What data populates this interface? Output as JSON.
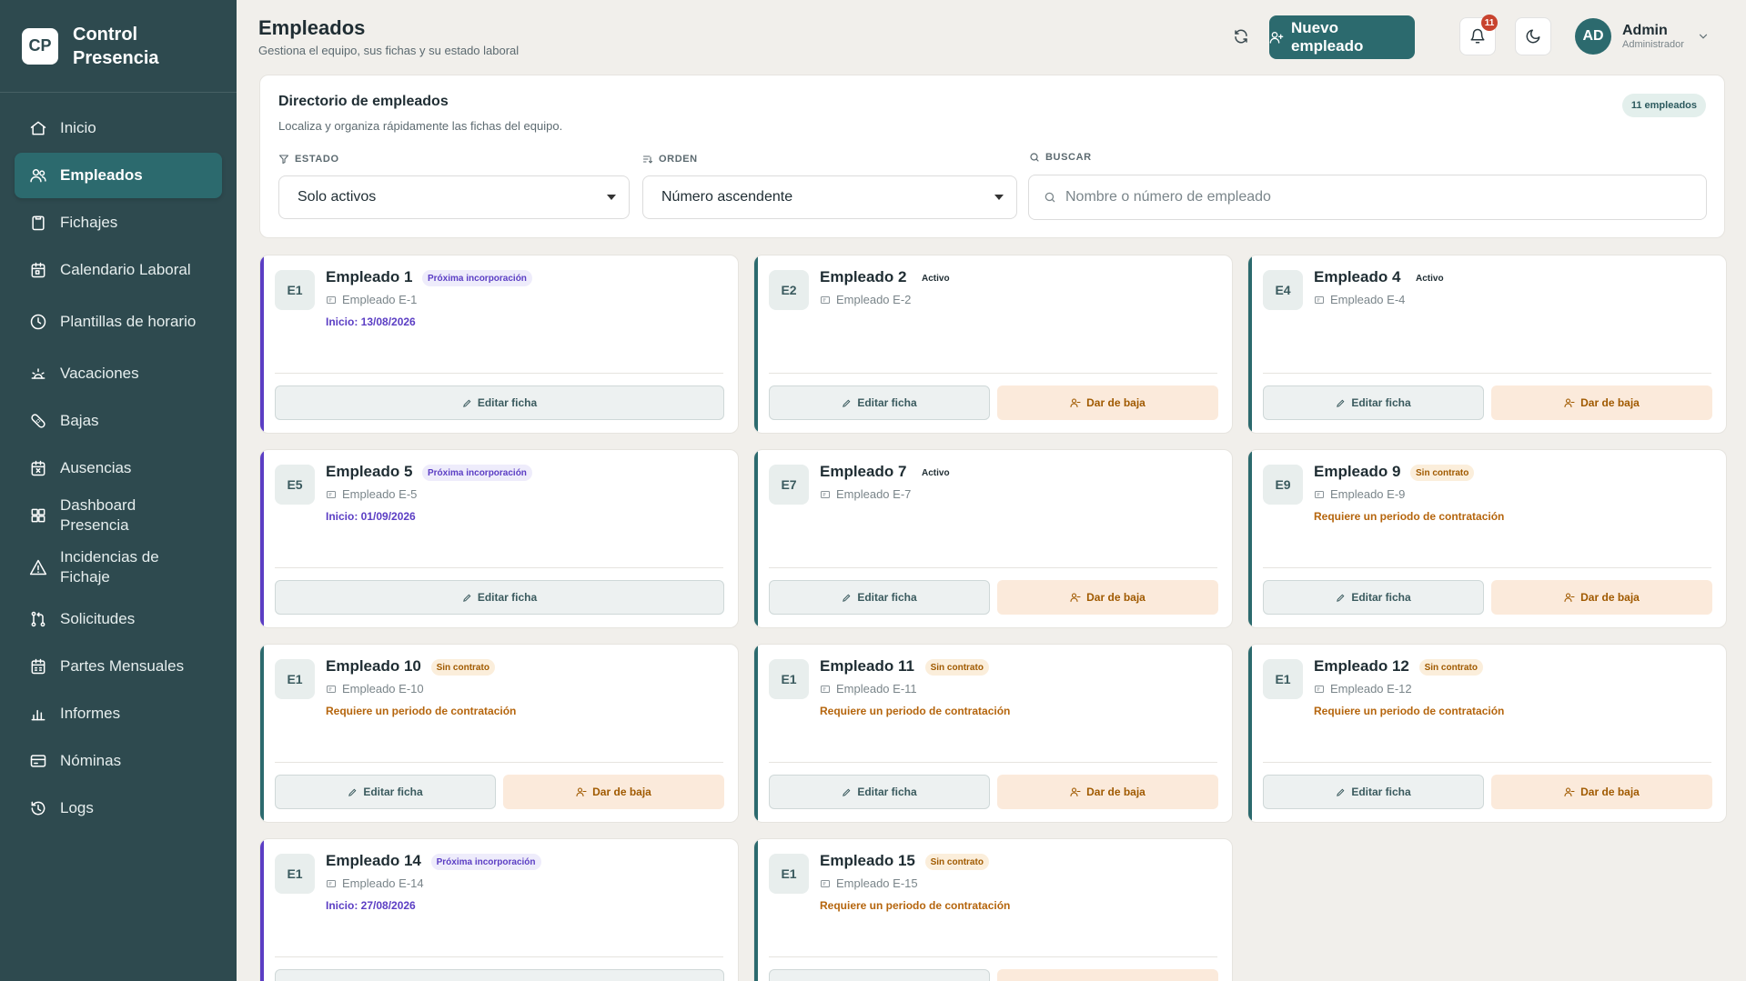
{
  "brand": {
    "logo": "CP",
    "name": "Control Presencia"
  },
  "nav": [
    {
      "label": "Inicio",
      "icon": "home-icon"
    },
    {
      "label": "Empleados",
      "icon": "users-icon",
      "active": true
    },
    {
      "label": "Fichajes",
      "icon": "clipboard-icon"
    },
    {
      "label": "Calendario Laboral",
      "icon": "calendar-icon"
    },
    {
      "label": "Plantillas de horario",
      "icon": "clock-icon"
    },
    {
      "label": "Vacaciones",
      "icon": "sun-icon"
    },
    {
      "label": "Bajas",
      "icon": "bandage-icon"
    },
    {
      "label": "Ausencias",
      "icon": "calendar-x-icon"
    },
    {
      "label": "Dashboard Presencia",
      "icon": "grid-icon"
    },
    {
      "label": "Incidencias de Fichaje",
      "icon": "warning-icon"
    },
    {
      "label": "Solicitudes",
      "icon": "git-pull-icon"
    },
    {
      "label": "Partes Mensuales",
      "icon": "calendar-grid-icon"
    },
    {
      "label": "Informes",
      "icon": "bar-chart-icon"
    },
    {
      "label": "Nóminas",
      "icon": "payslip-icon"
    },
    {
      "label": "Logs",
      "icon": "history-icon"
    }
  ],
  "header": {
    "title": "Empleados",
    "subtitle": "Gestiona el equipo, sus fichas y su estado laboral",
    "new_button": "Nuevo empleado",
    "notifications_count": "11",
    "user_initials": "AD",
    "user_name": "Admin",
    "user_role": "Administrador"
  },
  "directory": {
    "title": "Directorio de empleados",
    "subtitle": "Localiza y organiza rápidamente las fichas del equipo.",
    "count": "11 empleados",
    "estado_label": "ESTADO",
    "estado_value": "Solo activos",
    "orden_label": "ORDEN",
    "orden_value": "Número ascendente",
    "buscar_label": "BUSCAR",
    "search_placeholder": "Nombre o número de empleado"
  },
  "actions": {
    "edit": "Editar ficha",
    "baja": "Dar de baja"
  },
  "colors": {
    "accent": "#2c6a6e",
    "sidebar": "#2e4a4f",
    "upcoming": "#5b3ec4",
    "warning": "#b5650d"
  },
  "employees": [
    {
      "initials": "E1",
      "name": "Empleado 1",
      "status": "Próxima incorporación",
      "code": "Empleado E-1",
      "note": "Inicio: 13/08/2026"
    },
    {
      "initials": "E2",
      "name": "Empleado 2",
      "status": "Activo",
      "code": "Empleado E-2",
      "note": ""
    },
    {
      "initials": "E4",
      "name": "Empleado 4",
      "status": "Activo",
      "code": "Empleado E-4",
      "note": ""
    },
    {
      "initials": "E5",
      "name": "Empleado 5",
      "status": "Próxima incorporación",
      "code": "Empleado E-5",
      "note": "Inicio: 01/09/2026"
    },
    {
      "initials": "E7",
      "name": "Empleado 7",
      "status": "Activo",
      "code": "Empleado E-7",
      "note": ""
    },
    {
      "initials": "E9",
      "name": "Empleado 9",
      "status": "Sin contrato",
      "code": "Empleado E-9",
      "note": "Requiere un periodo de contratación"
    },
    {
      "initials": "E1",
      "name": "Empleado 10",
      "status": "Sin contrato",
      "code": "Empleado E-10",
      "note": "Requiere un periodo de contratación"
    },
    {
      "initials": "E1",
      "name": "Empleado 11",
      "status": "Sin contrato",
      "code": "Empleado E-11",
      "note": "Requiere un periodo de contratación"
    },
    {
      "initials": "E1",
      "name": "Empleado 12",
      "status": "Sin contrato",
      "code": "Empleado E-12",
      "note": "Requiere un periodo de contratación"
    },
    {
      "initials": "E1",
      "name": "Empleado 14",
      "status": "Próxima incorporación",
      "code": "Empleado E-14",
      "note": "Inicio: 27/08/2026"
    },
    {
      "initials": "E1",
      "name": "Empleado 15",
      "status": "Sin contrato",
      "code": "Empleado E-15",
      "note": "Requiere un periodo de contratación"
    }
  ]
}
